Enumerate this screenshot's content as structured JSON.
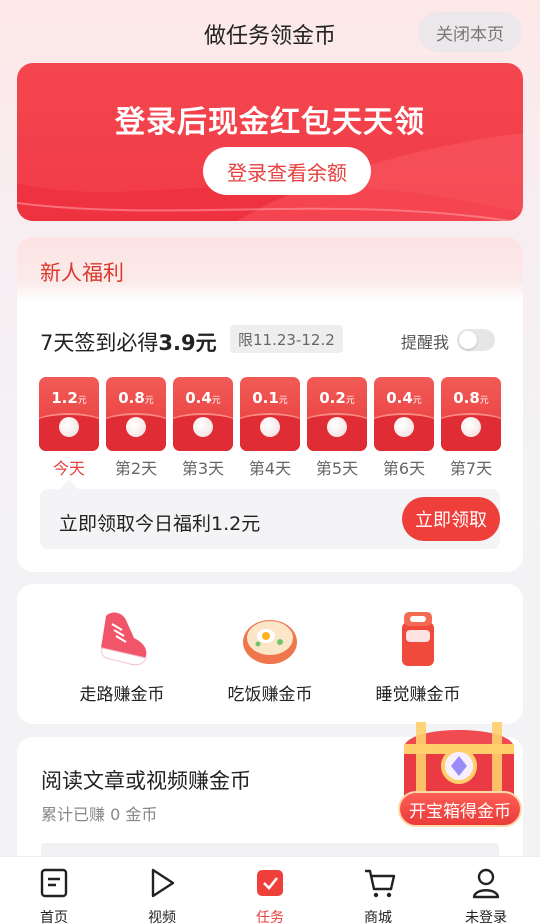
{
  "header": {
    "title": "做任务领金币",
    "close_label": "关闭本页"
  },
  "banner": {
    "title": "登录后现金红包天天领",
    "button_label": "登录查看余额"
  },
  "welfare": {
    "section_title": "新人福利",
    "sign_title_prefix": "7天签到必得",
    "sign_amount": "3.9元",
    "limit_tag": "限11.23-12.2",
    "remind_label": "提醒我",
    "remind_on": false,
    "unit": "元",
    "days": [
      {
        "amount": "1.2",
        "label": "今天"
      },
      {
        "amount": "0.8",
        "label": "第2天"
      },
      {
        "amount": "0.4",
        "label": "第3天"
      },
      {
        "amount": "0.1",
        "label": "第4天"
      },
      {
        "amount": "0.2",
        "label": "第5天"
      },
      {
        "amount": "0.4",
        "label": "第6天"
      },
      {
        "amount": "0.8",
        "label": "第7天"
      }
    ],
    "claim_text": "立即领取今日福利1.2元",
    "claim_button": "立即领取"
  },
  "earn": {
    "items": [
      {
        "label": "走路赚金币",
        "icon": "sneaker-icon"
      },
      {
        "label": "吃饭赚金币",
        "icon": "noodle-bowl-icon"
      },
      {
        "label": "睡觉赚金币",
        "icon": "thermos-icon"
      }
    ]
  },
  "read": {
    "title": "阅读文章或视频赚金币",
    "subtitle": "累计已赚 0 金币"
  },
  "treasure": {
    "label": "开宝箱得金币"
  },
  "nav": {
    "items": [
      {
        "label": "首页",
        "icon": "home-doc-icon"
      },
      {
        "label": "视频",
        "icon": "play-icon"
      },
      {
        "label": "任务",
        "icon": "task-check-icon"
      },
      {
        "label": "商城",
        "icon": "cart-icon"
      },
      {
        "label": "未登录",
        "icon": "user-icon"
      }
    ]
  },
  "colors": {
    "accent": "#e8403f",
    "banner": "#f13b47",
    "welfare_title": "#d93a2c"
  }
}
